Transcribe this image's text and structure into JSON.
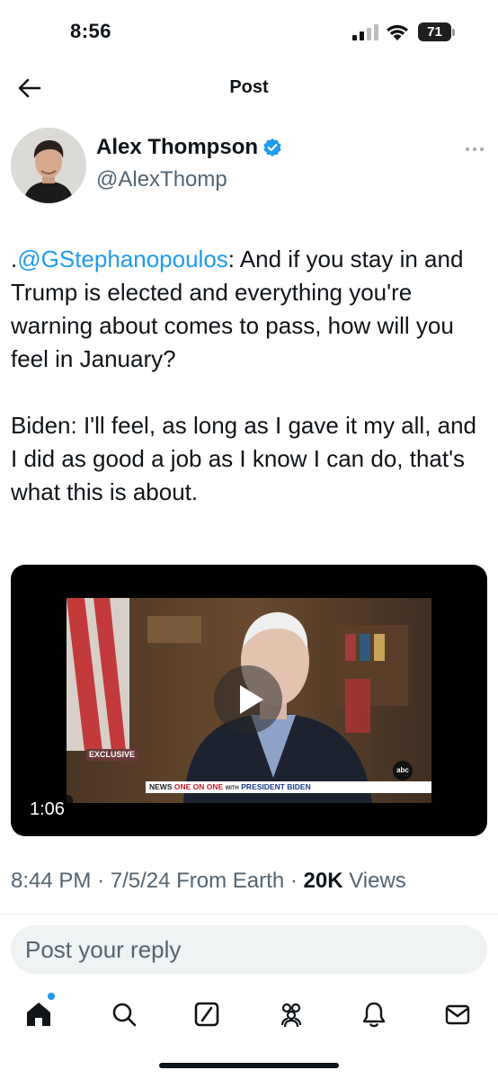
{
  "status_bar": {
    "time": "8:56",
    "battery_level": "71"
  },
  "header": {
    "title": "Post",
    "back_icon": "arrow-left-icon"
  },
  "author": {
    "name": "Alex Thompson",
    "handle": "@AlexThomp",
    "verified": true,
    "verified_color": "#1d9bf0"
  },
  "post": {
    "mention": "@GStephanopoulos",
    "text_prefix": ".",
    "text_after_mention": ": And if you stay in and Trump is elected and everything you're warning about comes to pass, how will you feel in January?\n\nBiden: I'll feel, as long as I gave it my all, and I did as good a job as I know I can do, that's what this is about.",
    "video": {
      "duration": "1:06",
      "exclusive_tag": "EXCLUSIVE",
      "lower_third_network": "NEWS",
      "lower_third_show": "ONE ON ONE",
      "lower_third_with": "WITH",
      "lower_third_guest": "PRESIDENT BIDEN",
      "network_logo": "abc"
    },
    "time": "8:44 PM",
    "date": "7/5/24",
    "location": "From Earth",
    "views_count": "20K",
    "views_label": "Views"
  },
  "reply": {
    "placeholder": "Post your reply"
  },
  "tab_bar": {
    "items": [
      {
        "name": "home",
        "icon": "home-icon",
        "active": true
      },
      {
        "name": "search",
        "icon": "search-icon"
      },
      {
        "name": "grok",
        "icon": "grok-icon"
      },
      {
        "name": "communities",
        "icon": "communities-icon"
      },
      {
        "name": "notifications",
        "icon": "bell-icon"
      },
      {
        "name": "messages",
        "icon": "envelope-icon"
      }
    ]
  },
  "colors": {
    "accent": "#1d9bf0",
    "text_primary": "#0f1419",
    "text_secondary": "#536471"
  }
}
